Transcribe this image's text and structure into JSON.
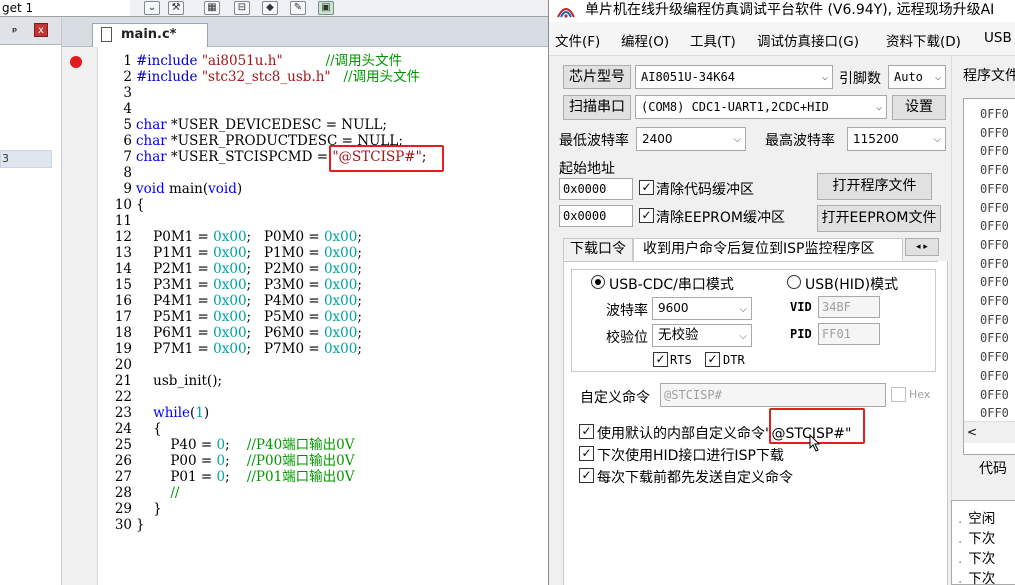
{
  "project_pane": {
    "target_combo": "get 1",
    "pin": " p",
    "close": "x",
    "tree_selected_fragment": "3"
  },
  "toolbar": {
    "icons": [
      "select-target-dropdown",
      "target-options-icon",
      "translate-icon",
      "build-icon",
      "rebuild-icon",
      "batch-build-icon",
      "stop-build-icon",
      "download-icon"
    ]
  },
  "editor": {
    "tab": "main.c*",
    "lines": [
      {
        "n": "1",
        "parts": [
          [
            "pre",
            "#include"
          ],
          [
            "txt",
            " "
          ],
          [
            "str",
            "\"ai8051u.h\""
          ],
          [
            "txt",
            "          "
          ],
          [
            "cmt",
            "//调用头文件"
          ]
        ]
      },
      {
        "n": "2",
        "parts": [
          [
            "pre",
            "#include"
          ],
          [
            "txt",
            " "
          ],
          [
            "str",
            "\"stc32_stc8_usb.h\""
          ],
          [
            "txt",
            "   "
          ],
          [
            "cmt",
            "//调用头文件"
          ]
        ]
      },
      {
        "n": "3",
        "parts": []
      },
      {
        "n": "4",
        "parts": []
      },
      {
        "n": "5",
        "parts": [
          [
            "kw",
            "char"
          ],
          [
            "txt",
            " *USER_DEVICEDESC = NULL;"
          ]
        ]
      },
      {
        "n": "6",
        "parts": [
          [
            "kw",
            "char"
          ],
          [
            "txt",
            " *USER_PRODUCTDESC = NULL;"
          ]
        ]
      },
      {
        "n": "7",
        "parts": [
          [
            "kw",
            "char"
          ],
          [
            "txt",
            " *USER_STCISPCMD = "
          ],
          [
            "str",
            "\"@STCISP#\""
          ],
          [
            "txt",
            ";"
          ]
        ]
      },
      {
        "n": "8",
        "parts": []
      },
      {
        "n": "9",
        "parts": [
          [
            "kw",
            "void"
          ],
          [
            "txt",
            " main("
          ],
          [
            "kw",
            "void"
          ],
          [
            "txt",
            ")"
          ]
        ]
      },
      {
        "n": "10",
        "parts": [
          [
            "txt",
            "{"
          ]
        ]
      },
      {
        "n": "11",
        "parts": []
      },
      {
        "n": "12",
        "parts": [
          [
            "txt",
            "    P0M1 = "
          ],
          [
            "num",
            "0x00"
          ],
          [
            "txt",
            ";   P0M0 = "
          ],
          [
            "num",
            "0x00"
          ],
          [
            "txt",
            ";"
          ]
        ]
      },
      {
        "n": "13",
        "parts": [
          [
            "txt",
            "    P1M1 = "
          ],
          [
            "num",
            "0x00"
          ],
          [
            "txt",
            ";   P1M0 = "
          ],
          [
            "num",
            "0x00"
          ],
          [
            "txt",
            ";"
          ]
        ]
      },
      {
        "n": "14",
        "parts": [
          [
            "txt",
            "    P2M1 = "
          ],
          [
            "num",
            "0x00"
          ],
          [
            "txt",
            ";   P2M0 = "
          ],
          [
            "num",
            "0x00"
          ],
          [
            "txt",
            ";"
          ]
        ]
      },
      {
        "n": "15",
        "parts": [
          [
            "txt",
            "    P3M1 = "
          ],
          [
            "num",
            "0x00"
          ],
          [
            "txt",
            ";   P3M0 = "
          ],
          [
            "num",
            "0x00"
          ],
          [
            "txt",
            ";"
          ]
        ]
      },
      {
        "n": "16",
        "parts": [
          [
            "txt",
            "    P4M1 = "
          ],
          [
            "num",
            "0x00"
          ],
          [
            "txt",
            ";   P4M0 = "
          ],
          [
            "num",
            "0x00"
          ],
          [
            "txt",
            ";"
          ]
        ]
      },
      {
        "n": "17",
        "parts": [
          [
            "txt",
            "    P5M1 = "
          ],
          [
            "num",
            "0x00"
          ],
          [
            "txt",
            ";   P5M0 = "
          ],
          [
            "num",
            "0x00"
          ],
          [
            "txt",
            ";"
          ]
        ]
      },
      {
        "n": "18",
        "parts": [
          [
            "txt",
            "    P6M1 = "
          ],
          [
            "num",
            "0x00"
          ],
          [
            "txt",
            ";   P6M0 = "
          ],
          [
            "num",
            "0x00"
          ],
          [
            "txt",
            ";"
          ]
        ]
      },
      {
        "n": "19",
        "parts": [
          [
            "txt",
            "    P7M1 = "
          ],
          [
            "num",
            "0x00"
          ],
          [
            "txt",
            ";   P7M0 = "
          ],
          [
            "num",
            "0x00"
          ],
          [
            "txt",
            ";"
          ]
        ]
      },
      {
        "n": "20",
        "parts": []
      },
      {
        "n": "21",
        "parts": [
          [
            "txt",
            "    usb_init();"
          ]
        ]
      },
      {
        "n": "22",
        "parts": []
      },
      {
        "n": "23",
        "parts": [
          [
            "txt",
            "    "
          ],
          [
            "kw",
            "while"
          ],
          [
            "txt",
            "("
          ],
          [
            "num",
            "1"
          ],
          [
            "txt",
            ")"
          ]
        ]
      },
      {
        "n": "24",
        "parts": [
          [
            "txt",
            "    {"
          ]
        ]
      },
      {
        "n": "25",
        "parts": [
          [
            "txt",
            "        P40 = "
          ],
          [
            "num",
            "0"
          ],
          [
            "txt",
            ";    "
          ],
          [
            "cmt",
            "//P40端口输出0V"
          ]
        ]
      },
      {
        "n": "26",
        "parts": [
          [
            "txt",
            "        P00 = "
          ],
          [
            "num",
            "0"
          ],
          [
            "txt",
            ";    "
          ],
          [
            "cmt",
            "//P00端口输出0V"
          ]
        ]
      },
      {
        "n": "27",
        "parts": [
          [
            "txt",
            "        P01 = "
          ],
          [
            "num",
            "0"
          ],
          [
            "txt",
            ";    "
          ],
          [
            "cmt",
            "//P01端口输出0V"
          ]
        ]
      },
      {
        "n": "28",
        "parts": [
          [
            "txt",
            "        "
          ],
          [
            "cmt",
            "//"
          ]
        ]
      },
      {
        "n": "29",
        "parts": [
          [
            "txt",
            "    }"
          ]
        ]
      },
      {
        "n": "30",
        "parts": [
          [
            "txt",
            "}"
          ]
        ]
      }
    ]
  },
  "isp": {
    "title": "单片机在线升级编程仿真调试平台软件 (V6.94Y), 远程现场升级AI",
    "menu": [
      "文件(F)",
      "编程(O)",
      "工具(T)",
      "调试仿真接口(G)",
      "资料下载(D)",
      "USB"
    ],
    "chip_type_btn": "芯片型号",
    "chip_type_value": "AI8051U-34K64",
    "pin_count_label": "引脚数",
    "pin_count_value": "Auto",
    "scan_port_btn": "扫描串口",
    "port_value": "(COM8) CDC1-UART1,2CDC+HID",
    "settings_btn": "设置",
    "min_baud_label": "最低波特率",
    "min_baud_value": "2400",
    "max_baud_label": "最高波特率",
    "max_baud_value": "115200",
    "start_addr_label": "起始地址",
    "code_addr": "0x0000",
    "clear_code_label": "清除代码缓冲区",
    "open_program_btn": "打开程序文件",
    "eeprom_addr": "0x0000",
    "clear_eeprom_label": "清除EEPROM缓冲区",
    "open_eeprom_btn": "打开EEPROM文件",
    "tab_download": "下载口令",
    "tab_usermode": "收到用户命令后复位到ISP监控程序区",
    "tab_scroll": "◂ ▸",
    "mode_cdc": "USB-CDC/串口模式",
    "mode_hid": "USB(HID)模式",
    "baud_label": "波特率",
    "baud_value": "9600",
    "parity_label": "校验位",
    "parity_value": "无校验",
    "rts_label": "RTS",
    "dtr_label": "DTR",
    "vid_label": "VID",
    "vid_value": "34BF",
    "pid_label": "PID",
    "pid_value": "FF01",
    "custom_cmd_label": "自定义命令",
    "custom_cmd_value": "@STCISP#",
    "hex_label": "Hex",
    "use_default_cmd": "使用默认的内部自定义命令\"@STCISP#\"",
    "use_hid_next": "下次使用HID接口进行ISP下载",
    "send_before_download": "每次下载前都先发送自定义命令",
    "file_list_title": "程序文件",
    "hex_rows": [
      "0FF0",
      "0FF0",
      "0FF0",
      "0FF0",
      "0FF0",
      "0FF0",
      "0FF0",
      "0FF0",
      "0FF0",
      "0FF0",
      "0FF0",
      "0FF0",
      "0FF0",
      "0FF0",
      "0FF0",
      "0FF0",
      "0FF0"
    ],
    "scroll_left": "<",
    "code_label": "代码",
    "log_lines": [
      "空闲",
      "下次",
      "下次",
      "下次"
    ],
    "checked_mark": "✓"
  }
}
